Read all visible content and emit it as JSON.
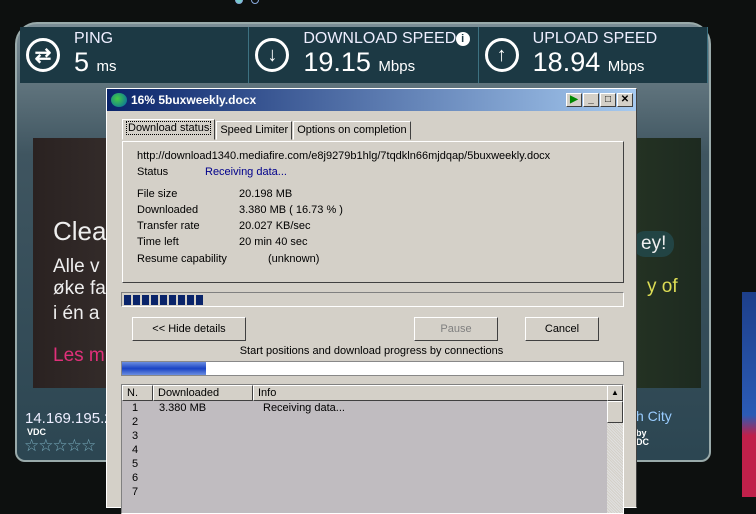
{
  "speedtest": {
    "ping": {
      "label": "PING",
      "value": "5",
      "unit": "ms"
    },
    "download": {
      "label": "DOWNLOAD SPEED",
      "value": "19.15",
      "unit": "Mbps"
    },
    "upload": {
      "label": "UPLOAD SPEED",
      "value": "18.94",
      "unit": "Mbps"
    },
    "ip": "14.169.195.2",
    "isp": "VDC",
    "city": "h City",
    "host_by": "by",
    "host": "DC",
    "ad_lines": [
      "Clea",
      "Alle v",
      "øke fa",
      "i én a",
      "Les m"
    ],
    "ad_right": [
      "ey!",
      "y of"
    ]
  },
  "dialog": {
    "title": "16% 5buxweekly.docx",
    "tabs": [
      "Download status",
      "Speed Limiter",
      "Options on completion"
    ],
    "url": "http://download1340.mediafire.com/e8j9279b1hlg/7tqdkln66mjdqap/5buxweekly.docx",
    "status_label": "Status",
    "status": "Receiving data...",
    "fields": [
      {
        "label": "File size",
        "value": "20.198  MB"
      },
      {
        "label": "Downloaded",
        "value": "3.380  MB  ( 16.73 % )"
      },
      {
        "label": "Transfer rate",
        "value": "20.027  KB/sec"
      },
      {
        "label": "Time left",
        "value": "20 min 40 sec"
      }
    ],
    "resume_label": "Resume capability",
    "resume": "(unknown)",
    "progress_percent": 16.73,
    "hide_details": "<< Hide details",
    "pause": "Pause",
    "cancel": "Cancel",
    "connections_caption": "Start positions and download progress by connections",
    "columns": [
      "N.",
      "Downloaded",
      "Info"
    ],
    "rows": [
      {
        "n": "1",
        "downloaded": "3.380  MB",
        "info": "Receiving data..."
      },
      {
        "n": "2",
        "downloaded": "",
        "info": ""
      },
      {
        "n": "3",
        "downloaded": "",
        "info": ""
      },
      {
        "n": "4",
        "downloaded": "",
        "info": ""
      },
      {
        "n": "5",
        "downloaded": "",
        "info": ""
      },
      {
        "n": "6",
        "downloaded": "",
        "info": ""
      },
      {
        "n": "7",
        "downloaded": "",
        "info": ""
      }
    ]
  }
}
